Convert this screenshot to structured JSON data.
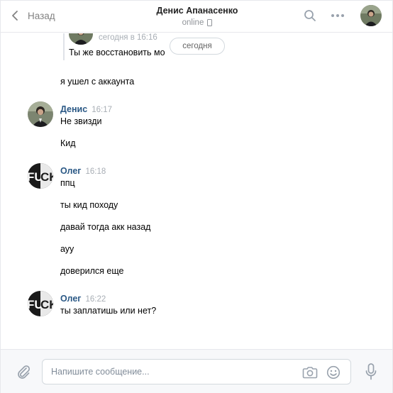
{
  "header": {
    "back_label": "Назад",
    "contact_name": "Денис Апанасенко",
    "status": "online"
  },
  "feed": {
    "quote": {
      "meta": "сегодня в 16:16",
      "text": "Ты же восстановить мо"
    },
    "date_divider": "сегодня",
    "standalone_message": "я ушел с аккаунта",
    "groups": [
      {
        "author": "Денис",
        "time": "16:17",
        "avatar_icon": "person-photo",
        "messages": [
          "Не звизди",
          "Кид"
        ]
      },
      {
        "author": "Олег",
        "time": "16:18",
        "avatar_icon": "fuck-logo",
        "messages": [
          "ппц",
          "ты кид походу",
          "давай тогда акк назад",
          "ауу",
          "доверился еще"
        ]
      },
      {
        "author": "Олег",
        "time": "16:22",
        "avatar_icon": "fuck-logo",
        "messages": [
          "ты заплатишь или нет?"
        ]
      }
    ]
  },
  "composer": {
    "placeholder": "Напишите сообщение..."
  },
  "colors": {
    "author_link": "#2a5885",
    "muted": "#a8aeb5",
    "border": "#e7e8ec",
    "footer_bg": "#f7f8fa"
  }
}
